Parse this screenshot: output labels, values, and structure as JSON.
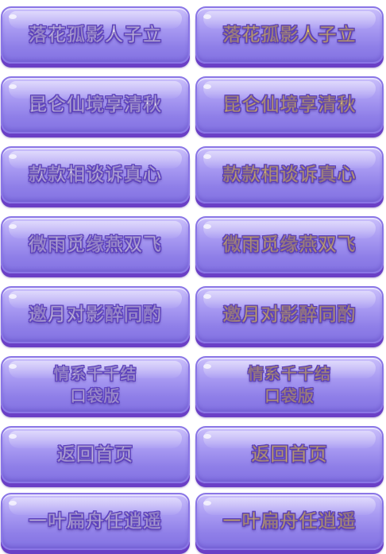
{
  "buttons_white": [
    {
      "label": "落花孤影人子立"
    },
    {
      "label": "昆仑仙境享清秋"
    },
    {
      "label": "款款相谈诉真心"
    },
    {
      "label": "微雨觅缘燕双飞"
    },
    {
      "label": "邀月对影醉同酌"
    },
    {
      "line1": "情系千千结",
      "line2": "口袋版"
    },
    {
      "label": "返回首页"
    },
    {
      "label": "一叶扁舟任逍遥"
    }
  ],
  "buttons_yellow": [
    {
      "label": "落花孤影人子立"
    },
    {
      "label": "昆仑仙境享清秋"
    },
    {
      "label": "款款相谈诉真心"
    },
    {
      "label": "微雨觅缘燕双飞"
    },
    {
      "label": "邀月对影醉同酌"
    },
    {
      "line1": "情系千千结",
      "line2": "口袋版"
    },
    {
      "label": "返回首页"
    },
    {
      "label": "一叶扁舟任逍遥"
    }
  ],
  "colors": {
    "button_top": "#cabffb",
    "button_bottom": "#8372e2",
    "button_shadow": "#6a3fc6",
    "text_white": "#ffffff",
    "text_yellow": "#ffe25a",
    "text_outline": "#5b3fc0"
  }
}
